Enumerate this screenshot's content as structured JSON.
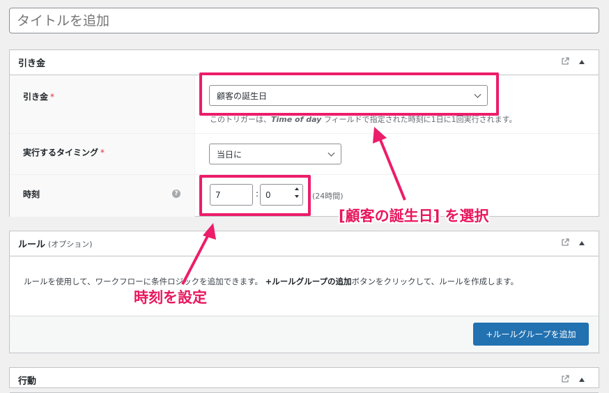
{
  "title_input": {
    "placeholder": "タイトルを追加"
  },
  "trigger_panel": {
    "title": "引き金",
    "trigger": {
      "label": "引き金",
      "required_mark": "*",
      "selected": "顧客の誕生日",
      "help_pre": "このトリガーは、",
      "help_em": "Time of day",
      "help_post": " フィールドで指定された時刻に1日に1回実行されます。"
    },
    "timing": {
      "label": "実行するタイミング",
      "required_mark": "*",
      "selected": "当日に"
    },
    "time": {
      "label": "時刻",
      "help_icon": "?",
      "hour": "7",
      "separator": ":",
      "minute": "0",
      "unit": "(24時間)"
    }
  },
  "rules_panel": {
    "title": "ルール",
    "subtitle": "(オプション)",
    "desc_pre": "ルールを使用して、ワークフローに条件ロジックを追加できます。 ",
    "desc_bold": "+ルールグループの追加",
    "desc_post": "ボタンをクリックして、ルールを作成します。",
    "add_button": "+ルールグループを追加"
  },
  "actions_panel": {
    "title": "行動"
  },
  "annotations": {
    "select_callout": "[顧客の誕生日] を選択",
    "time_callout": "時刻を設定",
    "color": "#ec1d6a"
  }
}
